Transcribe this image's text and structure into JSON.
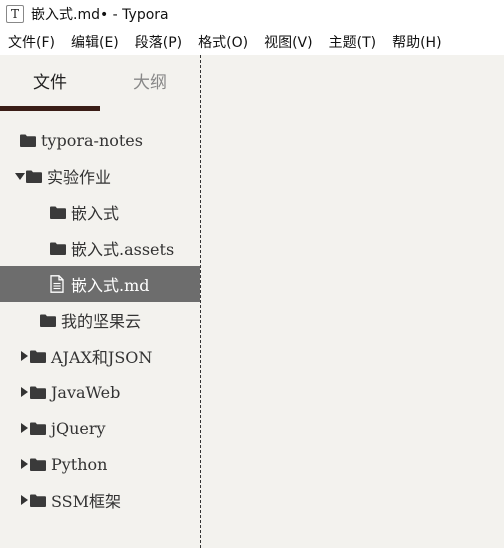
{
  "window": {
    "title": "嵌入式.md• - Typora",
    "app_icon": "T"
  },
  "menu": [
    "文件(F)",
    "编辑(E)",
    "段落(P)",
    "格式(O)",
    "视图(V)",
    "主题(T)",
    "帮助(H)"
  ],
  "sidebar": {
    "tabs": {
      "files": "文件",
      "outline": "大纲"
    },
    "tree": [
      {
        "label": "typora-notes",
        "type": "folder",
        "arrow": "none"
      },
      {
        "label": "实验作业",
        "type": "folder",
        "arrow": "down"
      },
      {
        "label": "嵌入式",
        "type": "folder",
        "arrow": "none"
      },
      {
        "label": "嵌入式.assets",
        "type": "folder",
        "arrow": "none"
      },
      {
        "label": "嵌入式.md",
        "type": "file",
        "arrow": "none",
        "selected": true
      },
      {
        "label": "我的坚果云",
        "type": "folder",
        "arrow": "none"
      },
      {
        "label": "AJAX和JSON",
        "type": "folder",
        "arrow": "right"
      },
      {
        "label": "JavaWeb",
        "type": "folder",
        "arrow": "right"
      },
      {
        "label": "jQuery",
        "type": "folder",
        "arrow": "right"
      },
      {
        "label": "Python",
        "type": "folder",
        "arrow": "right"
      },
      {
        "label": "SSM框架",
        "type": "folder",
        "arrow": "right"
      }
    ]
  },
  "colors": {
    "selected_bg": "#6d6d6d",
    "tab_underline": "#3a1d16",
    "background": "#f3f2ee"
  }
}
